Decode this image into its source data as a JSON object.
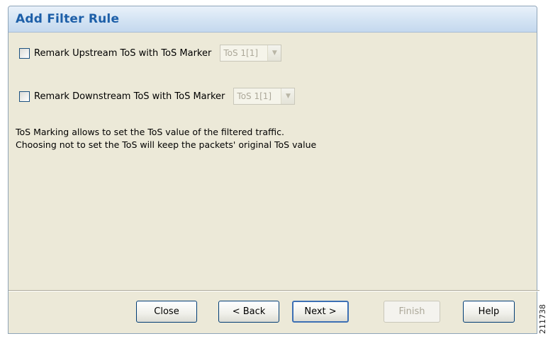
{
  "window": {
    "title": "Add Filter Rule"
  },
  "upstream": {
    "checkbox_label": "Remark Upstream ToS with ToS Marker",
    "checked": false,
    "select_value": "ToS 1[1]"
  },
  "downstream": {
    "checkbox_label": "Remark Downstream ToS with ToS Marker",
    "checked": false,
    "select_value": "ToS 1[1]"
  },
  "description": {
    "line1": "ToS Marking allows to set the ToS value of the filtered traffic.",
    "line2": "Choosing not to set the ToS will keep the packets' original ToS value"
  },
  "buttons": {
    "close": "Close",
    "back": "< Back",
    "next": "Next >",
    "finish": "Finish",
    "help": "Help"
  },
  "figure_id": "211738",
  "icons": {
    "dropdown": "chevron-down-icon"
  }
}
